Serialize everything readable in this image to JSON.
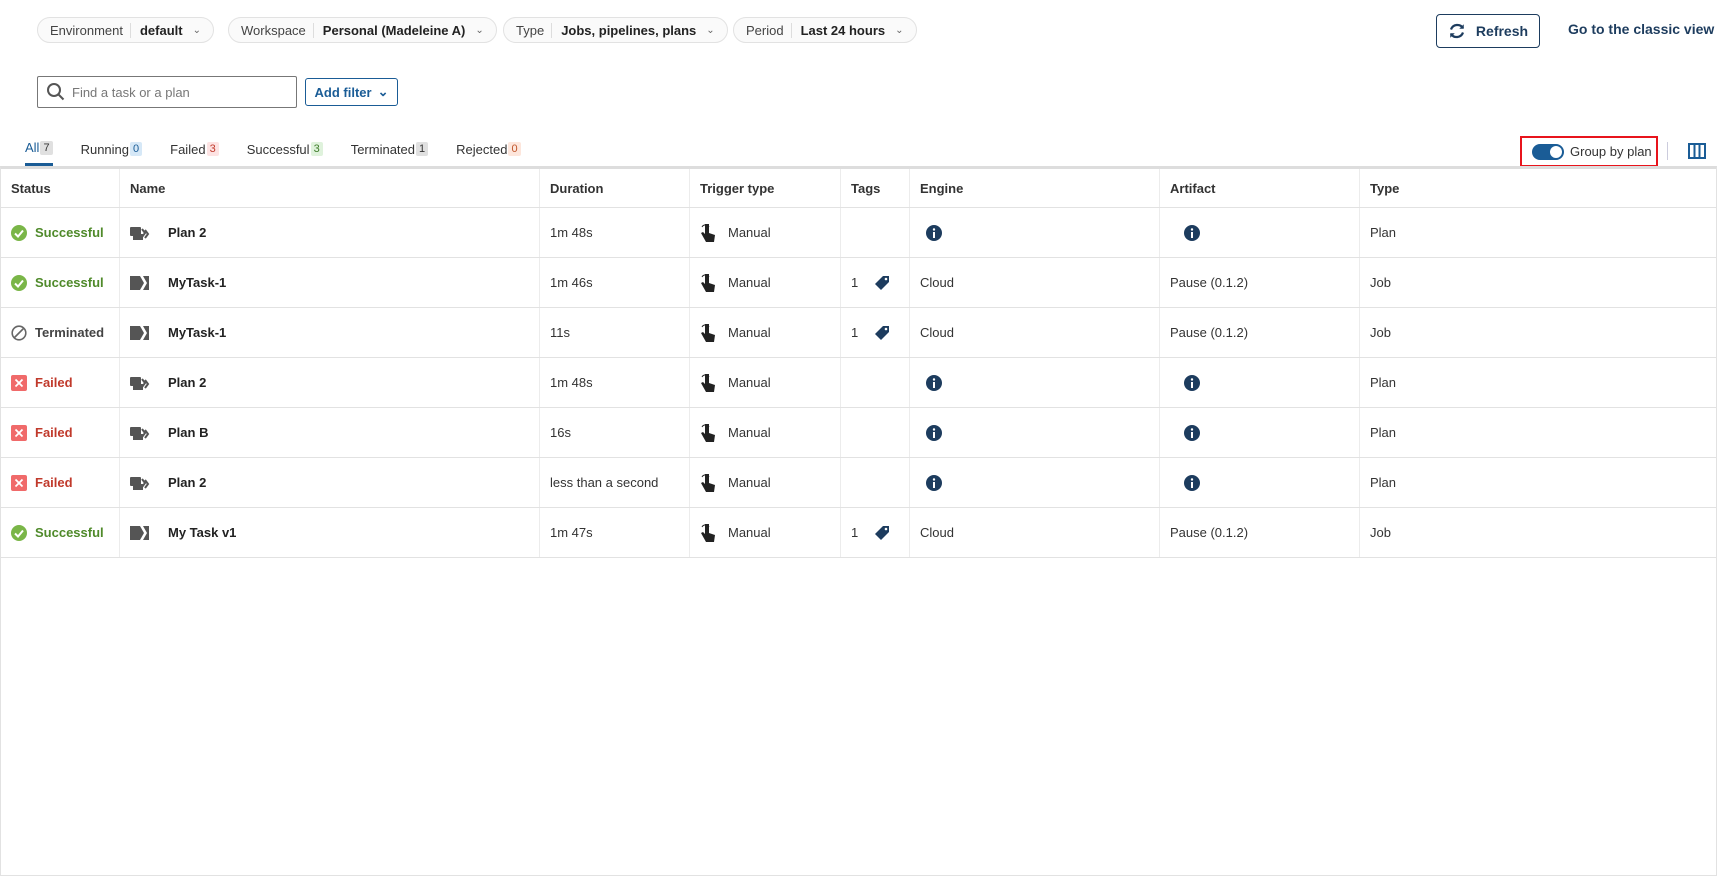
{
  "filters": [
    {
      "label": "Environment",
      "value": "default"
    },
    {
      "label": "Workspace",
      "value": "Personal (Madeleine A)"
    },
    {
      "label": "Type",
      "value": "Jobs, pipelines, plans"
    },
    {
      "label": "Period",
      "value": "Last 24 hours"
    }
  ],
  "header": {
    "refresh_label": "Refresh",
    "classic_view_label": "Go to the classic view"
  },
  "search": {
    "placeholder": "Find a task or a plan",
    "add_filter_label": "Add filter"
  },
  "tabs": [
    {
      "label": "All",
      "count": "7",
      "badge_bg": "#e0e0e0",
      "badge_color": "#333"
    },
    {
      "label": "Running",
      "count": "0",
      "badge_bg": "#d6e8f7",
      "badge_color": "#1a5c96"
    },
    {
      "label": "Failed",
      "count": "3",
      "badge_bg": "#fde3e3",
      "badge_color": "#c0392b"
    },
    {
      "label": "Successful",
      "count": "3",
      "badge_bg": "#dff2dc",
      "badge_color": "#3f7d2a"
    },
    {
      "label": "Terminated",
      "count": "1",
      "badge_bg": "#e0e0e0",
      "badge_color": "#333"
    },
    {
      "label": "Rejected",
      "count": "0",
      "badge_bg": "#fde6dc",
      "badge_color": "#c0562b"
    }
  ],
  "group_by_plan": {
    "label": "Group by plan",
    "enabled": true
  },
  "table": {
    "columns": [
      "Status",
      "Name",
      "Duration",
      "Trigger type",
      "Tags",
      "Engine",
      "Artifact",
      "Type"
    ],
    "rows": [
      {
        "status": "Successful",
        "name": "Plan 2",
        "kind": "plan",
        "duration": "1m 48s",
        "trigger": "Manual",
        "tags": "",
        "engine": "",
        "artifact": "",
        "type": "Plan"
      },
      {
        "status": "Successful",
        "name": "MyTask-1",
        "kind": "job",
        "duration": "1m 46s",
        "trigger": "Manual",
        "tags": "1",
        "engine": "Cloud",
        "artifact": "Pause (0.1.2)",
        "type": "Job"
      },
      {
        "status": "Terminated",
        "name": "MyTask-1",
        "kind": "job",
        "duration": "11s",
        "trigger": "Manual",
        "tags": "1",
        "engine": "Cloud",
        "artifact": "Pause (0.1.2)",
        "type": "Job"
      },
      {
        "status": "Failed",
        "name": "Plan 2",
        "kind": "plan",
        "duration": "1m 48s",
        "trigger": "Manual",
        "tags": "",
        "engine": "",
        "artifact": "",
        "type": "Plan"
      },
      {
        "status": "Failed",
        "name": "Plan B",
        "kind": "plan",
        "duration": "16s",
        "trigger": "Manual",
        "tags": "",
        "engine": "",
        "artifact": "",
        "type": "Plan"
      },
      {
        "status": "Failed",
        "name": "Plan 2",
        "kind": "plan",
        "duration": "less than a second",
        "trigger": "Manual",
        "tags": "",
        "engine": "",
        "artifact": "",
        "type": "Plan"
      },
      {
        "status": "Successful",
        "name": "My Task v1",
        "kind": "job",
        "duration": "1m 47s",
        "trigger": "Manual",
        "tags": "1",
        "engine": "Cloud",
        "artifact": "Pause (0.1.2)",
        "type": "Job"
      }
    ]
  },
  "colors": {
    "accent": "#1a5c96",
    "success": "#4f8a2a",
    "failed": "#c0392b",
    "highlight": "#e8141c"
  }
}
